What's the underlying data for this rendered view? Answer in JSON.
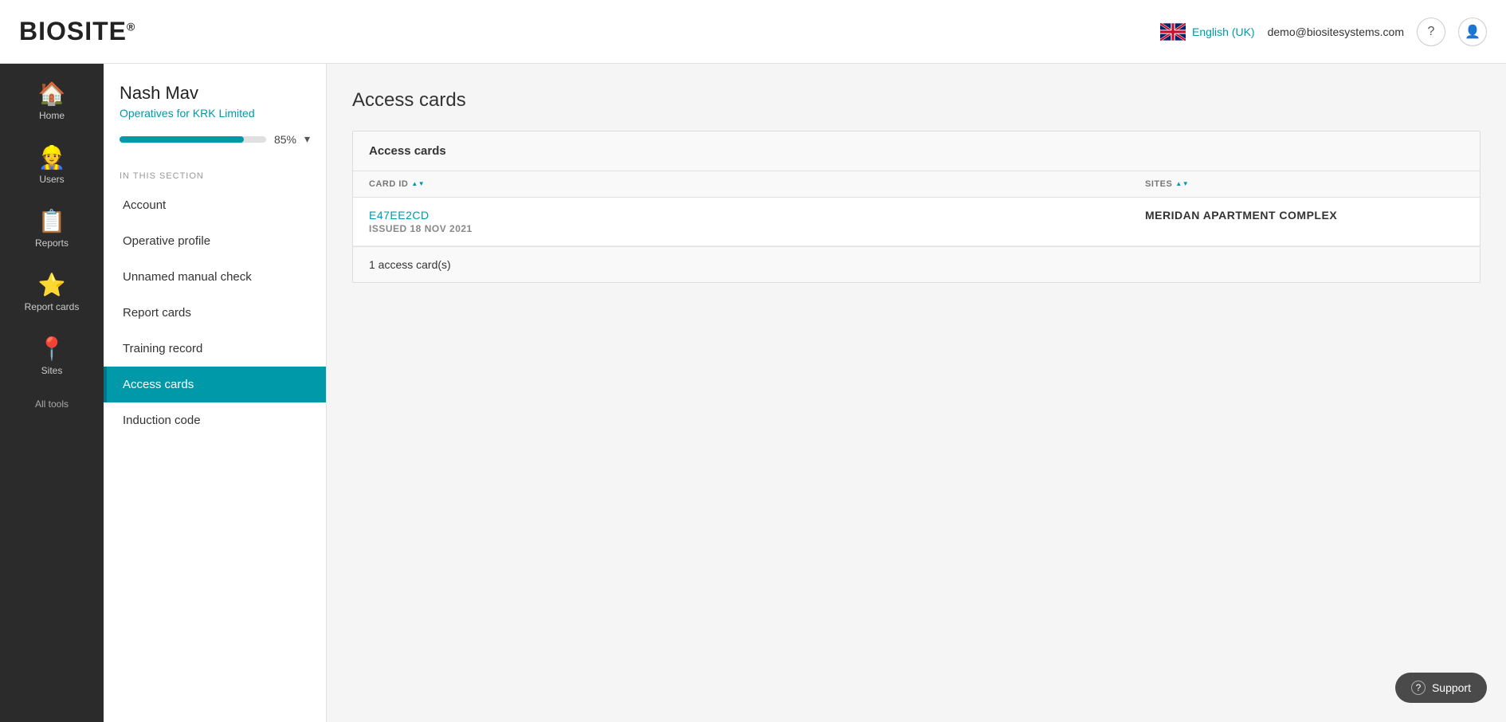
{
  "header": {
    "logo": "BIOSITE",
    "logo_reg": "®",
    "lang_label": "English (UK)",
    "user_email": "demo@biositesystems.com",
    "help_icon": "?",
    "user_icon": "👤"
  },
  "nav": {
    "items": [
      {
        "id": "home",
        "label": "Home",
        "icon": "🏠",
        "active": false
      },
      {
        "id": "users",
        "label": "Users",
        "icon": "👷",
        "active": false
      },
      {
        "id": "reports",
        "label": "Reports",
        "icon": "📋",
        "active": false
      },
      {
        "id": "report-cards",
        "label": "Report cards",
        "icon": "⭐",
        "active": false
      },
      {
        "id": "sites",
        "label": "Sites",
        "icon": "📍",
        "active": false
      }
    ],
    "all_tools": "All tools"
  },
  "sidebar": {
    "name": "Nash Mav",
    "subtitle": "Operatives for KRK Limited",
    "progress_pct": 85,
    "progress_label": "85%",
    "section_label": "IN THIS SECTION",
    "nav_items": [
      {
        "id": "account",
        "label": "Account",
        "active": false
      },
      {
        "id": "operative-profile",
        "label": "Operative profile",
        "active": false
      },
      {
        "id": "unnamed-manual-check",
        "label": "Unnamed manual check",
        "active": false
      },
      {
        "id": "report-cards",
        "label": "Report cards",
        "active": false
      },
      {
        "id": "training-record",
        "label": "Training record",
        "active": false
      },
      {
        "id": "access-cards",
        "label": "Access cards",
        "active": true
      },
      {
        "id": "induction-code",
        "label": "Induction code",
        "active": false
      }
    ]
  },
  "content": {
    "page_title": "Access cards",
    "section_title": "Access cards",
    "table": {
      "col_card_id": "CARD ID",
      "col_sites": "SITES",
      "rows": [
        {
          "card_id": "e47ee2cd",
          "issued": "Issued 18 Nov 2021",
          "sites": "Meridan Apartment Complex"
        }
      ]
    },
    "count_label": "1 access card(s)"
  },
  "support": {
    "label": "Support",
    "icon": "?"
  }
}
